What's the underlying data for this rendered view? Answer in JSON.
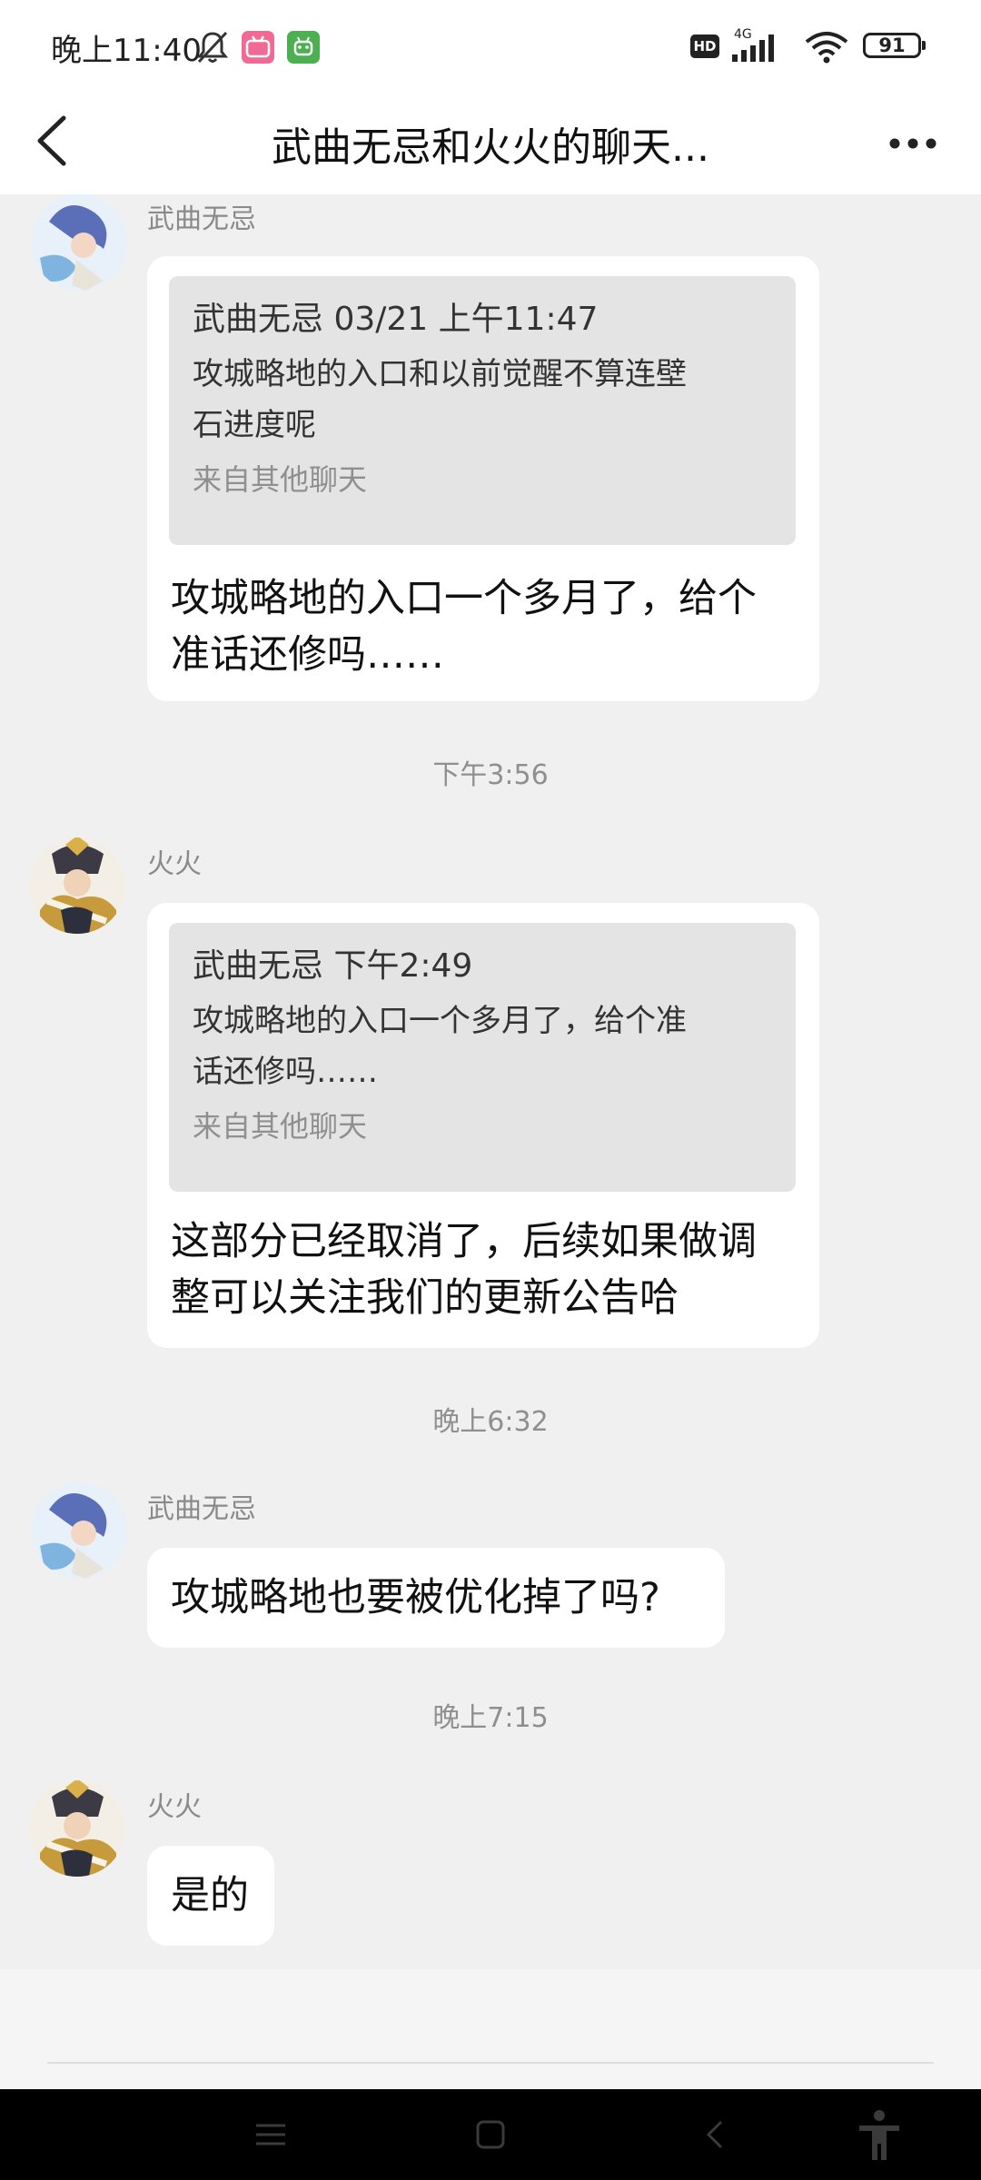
{
  "status_bar": {
    "time": "晚上11:40",
    "network": "4G",
    "hd": "HD",
    "battery": "91"
  },
  "header": {
    "title": "武曲无忌和火火的聊天..."
  },
  "messages": [
    {
      "sender": "武曲无忌",
      "quote": {
        "header": "武曲无忌 03/21 上午11:47",
        "text_line1": "攻城略地的入口和以前觉醒不算连壁",
        "text_line2": "石进度呢",
        "source": "来自其他聊天"
      },
      "text_line1": "攻城略地的入口一个多月了，给个",
      "text_line2": "准话还修吗……"
    },
    {
      "timestamp": "下午3:56"
    },
    {
      "sender": "火火",
      "quote": {
        "header": "武曲无忌  下午2:49",
        "text_line1": " 攻城略地的入口一个多月了，给个准",
        "text_line2": "话还修吗……",
        "source": "来自其他聊天"
      },
      "text_line1": "这部分已经取消了，后续如果做调",
      "text_line2": "整可以关注我们的更新公告哈"
    },
    {
      "timestamp": "晚上6:32"
    },
    {
      "sender": "武曲无忌",
      "text": "攻城略地也要被优化掉了吗?"
    },
    {
      "timestamp": "晚上7:15"
    },
    {
      "sender": "火火",
      "text": "是的"
    }
  ],
  "colors": {
    "background": "#f0f0f0",
    "bubble": "#ffffff",
    "quote_bg": "#e4e4e4",
    "secondary_text": "#8f8f8f",
    "navbar": "#000000"
  },
  "icons": {
    "status": [
      "mute-bell-icon",
      "bilibili-app-icon",
      "android-robot-app-icon",
      "signal-icon",
      "wifi-icon",
      "battery-icon"
    ],
    "header": [
      "back-chevron-icon",
      "more-dots-icon"
    ],
    "nav": [
      "menu-icon",
      "home-icon",
      "back-icon",
      "accessibility-icon"
    ]
  }
}
